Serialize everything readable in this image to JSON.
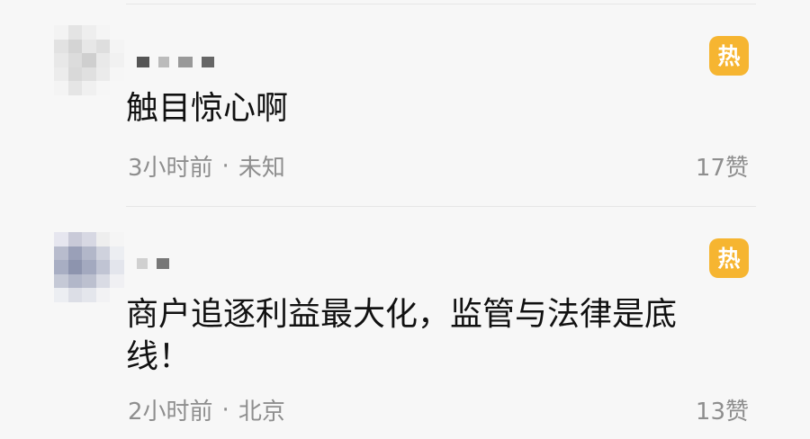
{
  "comments": [
    {
      "content": "触目惊心啊",
      "time": "3小时前",
      "separator": "·",
      "location": "未知",
      "likes": "17赞",
      "badge": "热",
      "badge_color": "#f6b531"
    },
    {
      "content": "商户追逐利益最大化，监管与法律是底线！",
      "time": "2小时前",
      "separator": "·",
      "location": "北京",
      "likes": "13赞",
      "badge": "热",
      "badge_color": "#f6b531"
    }
  ],
  "colors": {
    "background": "#f7f7f7",
    "text": "#111111",
    "meta": "#8e8e8e"
  }
}
